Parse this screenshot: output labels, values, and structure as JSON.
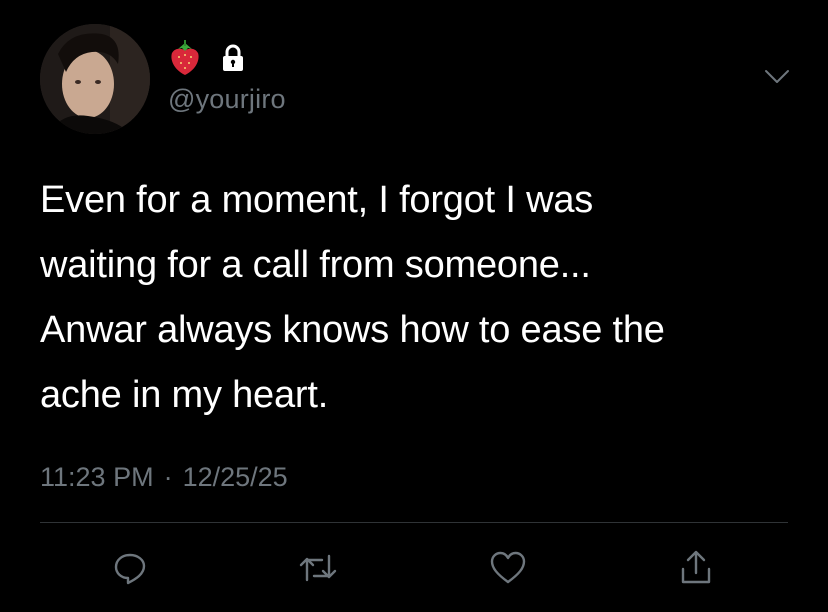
{
  "tweet": {
    "handle": "@yourjiro",
    "text": "Even for a moment, I forgot I was\nwaiting for a call from someone...\nAnwar always knows how to ease the\nache in my heart.",
    "time": "11:23 PM",
    "separator": "·",
    "date": "12/25/25",
    "name_icons": [
      "strawberry-icon",
      "lock-icon"
    ]
  },
  "actions": [
    {
      "name": "reply",
      "icon": "speech-bubble-icon"
    },
    {
      "name": "retweet",
      "icon": "retweet-icon"
    },
    {
      "name": "like",
      "icon": "heart-icon"
    },
    {
      "name": "share",
      "icon": "share-icon"
    }
  ],
  "colors": {
    "background": "#000000",
    "text": "#ffffff",
    "secondary": "#6e767d",
    "divider": "#2f3336"
  }
}
